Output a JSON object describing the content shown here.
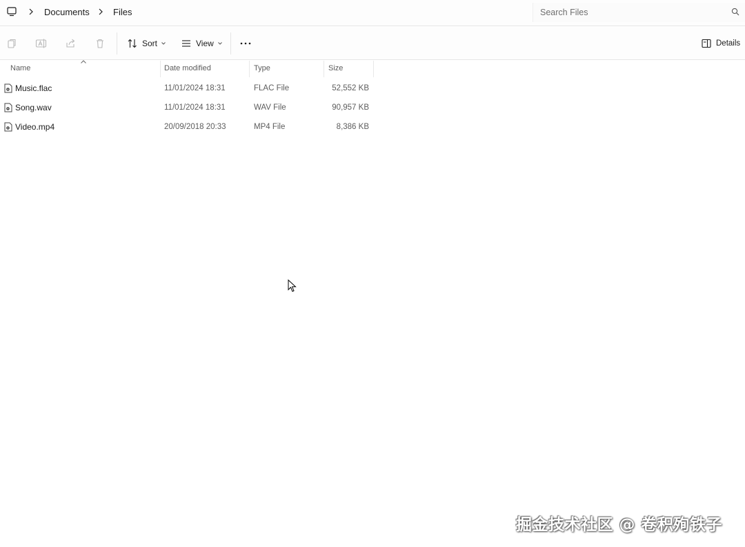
{
  "breadcrumb": {
    "items": [
      "Documents",
      "Files"
    ]
  },
  "search": {
    "placeholder": "Search Files"
  },
  "toolbar": {
    "sort_label": "Sort",
    "view_label": "View",
    "details_label": "Details"
  },
  "columns": {
    "name": "Name",
    "date": "Date modified",
    "type": "Type",
    "size": "Size"
  },
  "files": [
    {
      "name": "Music.flac",
      "date": "11/01/2024 18:31",
      "type": "FLAC File",
      "size": "52,552 KB",
      "icon": "audio-file-icon"
    },
    {
      "name": "Song.wav",
      "date": "11/01/2024 18:31",
      "type": "WAV File",
      "size": "90,957 KB",
      "icon": "audio-file-icon"
    },
    {
      "name": "Video.mp4",
      "date": "20/09/2018 20:33",
      "type": "MP4 File",
      "size": "8,386 KB",
      "icon": "video-file-icon"
    }
  ],
  "watermark": {
    "text": "掘金技术社区 @ 卷积殉铁子"
  }
}
